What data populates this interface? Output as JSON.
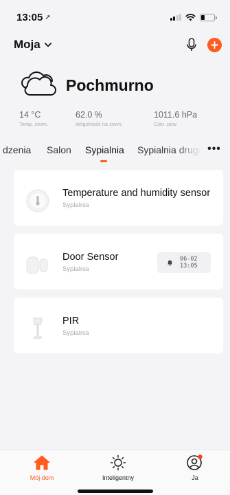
{
  "status_bar": {
    "time": "13:05",
    "location_arrow": "➚"
  },
  "header": {
    "home_name": "Moja"
  },
  "weather": {
    "condition": "Pochmurno",
    "stats": [
      {
        "value": "14 °C",
        "label": "Temp. zewn."
      },
      {
        "value": "62.0 %",
        "label": "Wilgotność na zewn."
      },
      {
        "value": "1011.6 hPa",
        "label": "Ciśn. pow."
      }
    ]
  },
  "tabs": [
    {
      "label": "dzenia"
    },
    {
      "label": "Salon"
    },
    {
      "label": "Sypialnia",
      "active": true
    },
    {
      "label": "Sypialnia druga"
    }
  ],
  "more_label": "•••",
  "devices": [
    {
      "name": "Temperature and humidity sensor",
      "room": "Sypialnia",
      "icon": "thermometer-sensor-icon"
    },
    {
      "name": "Door Sensor",
      "room": "Sypialnia",
      "icon": "door-sensor-icon",
      "alert": {
        "date": "06-02",
        "time": "13:05"
      }
    },
    {
      "name": "PIR",
      "room": "Sypialnia",
      "icon": "pir-sensor-icon"
    }
  ],
  "bottom_nav": [
    {
      "label": "Mój dom",
      "icon": "home-icon",
      "active": true
    },
    {
      "label": "Inteligentny",
      "icon": "sun-icon"
    },
    {
      "label": "Ja",
      "icon": "profile-icon"
    }
  ],
  "colors": {
    "accent": "#ff5a1f",
    "background": "#f4f4f6",
    "card": "#ffffff"
  }
}
